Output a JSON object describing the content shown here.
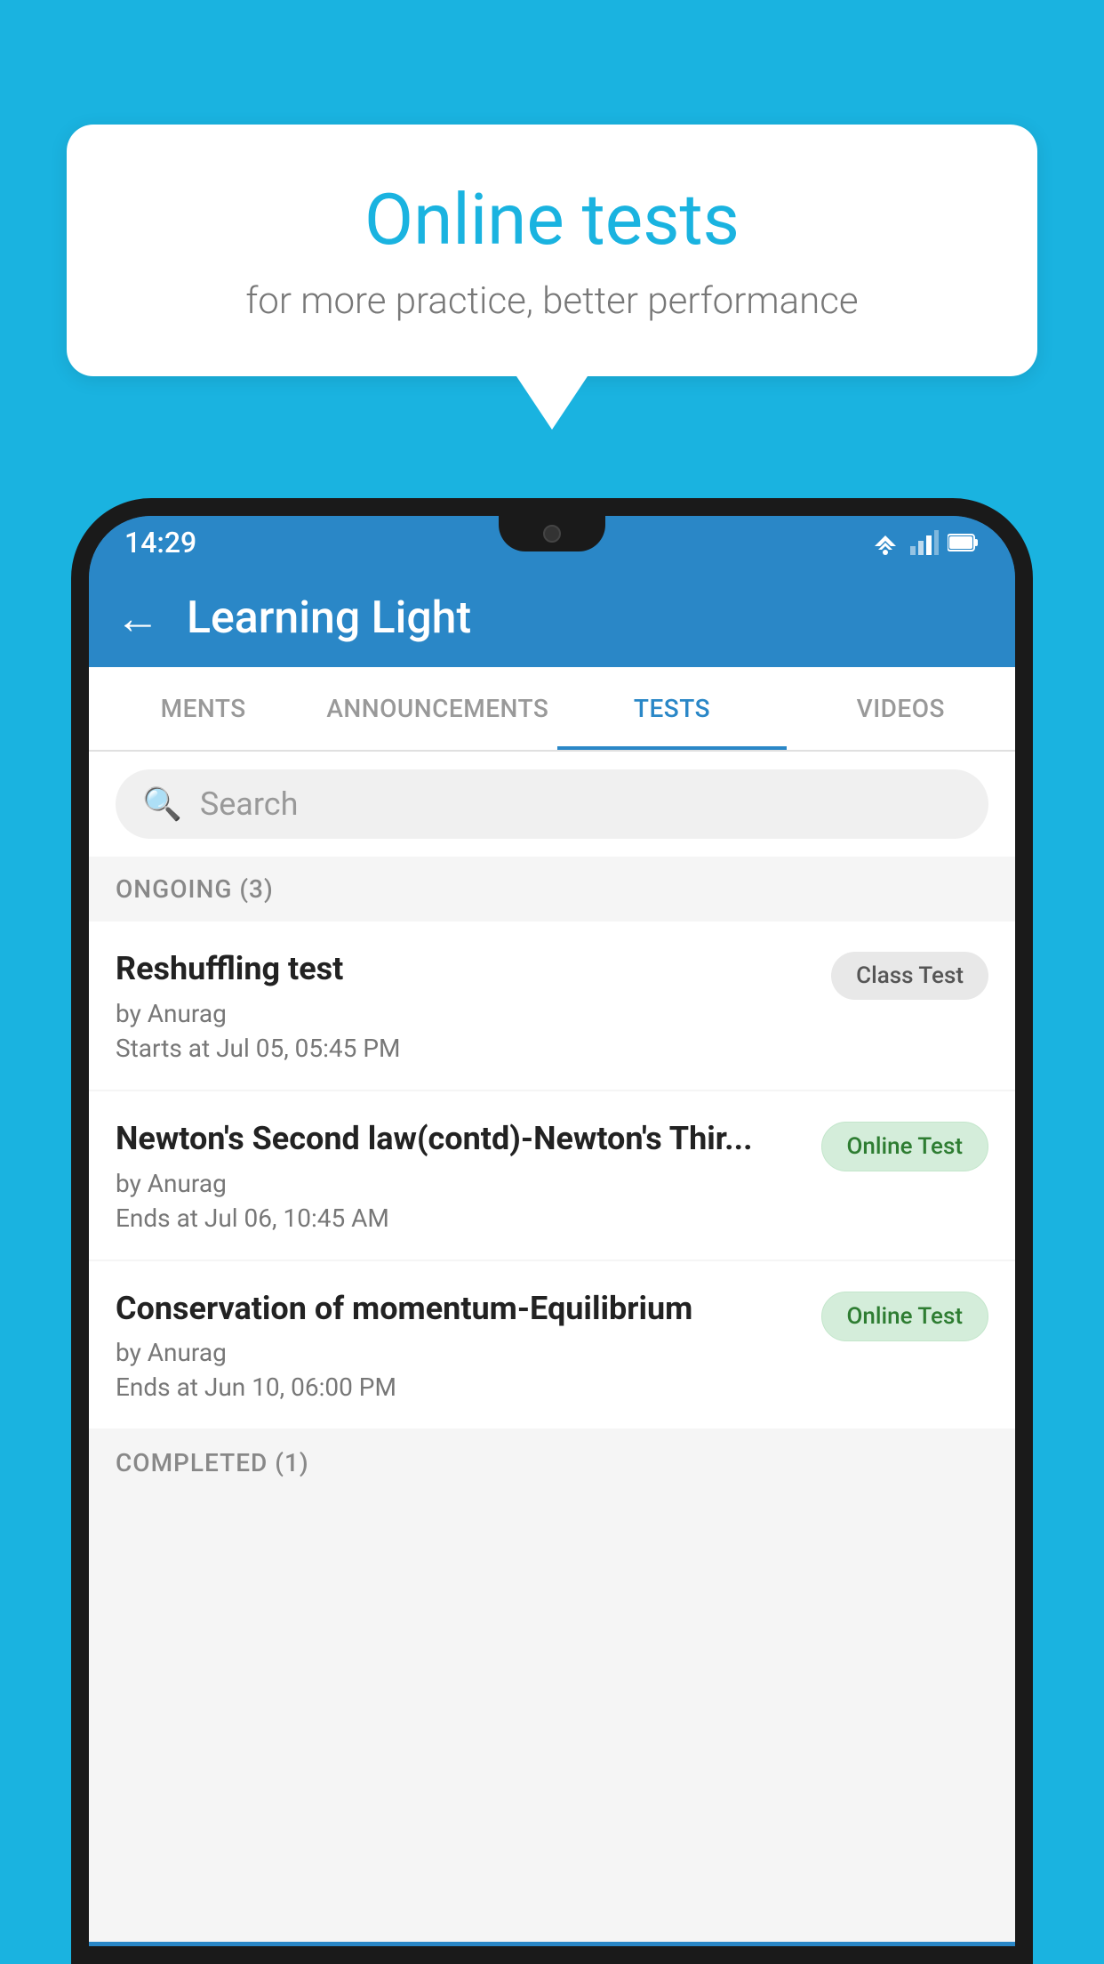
{
  "background_color": "#1ab3e0",
  "speech_bubble": {
    "title": "Online tests",
    "subtitle": "for more practice, better performance"
  },
  "status_bar": {
    "time": "14:29"
  },
  "app_bar": {
    "title": "Learning Light",
    "back_label": "←"
  },
  "tabs": [
    {
      "label": "MENTS",
      "active": false
    },
    {
      "label": "ANNOUNCEMENTS",
      "active": false
    },
    {
      "label": "TESTS",
      "active": true
    },
    {
      "label": "VIDEOS",
      "active": false
    }
  ],
  "search": {
    "placeholder": "Search"
  },
  "sections": [
    {
      "label": "ONGOING (3)",
      "tests": [
        {
          "title": "Reshuffling test",
          "author": "by Anurag",
          "time": "Starts at  Jul 05, 05:45 PM",
          "badge": "Class Test",
          "badge_type": "class"
        },
        {
          "title": "Newton's Second law(contd)-Newton's Thir...",
          "author": "by Anurag",
          "time": "Ends at  Jul 06, 10:45 AM",
          "badge": "Online Test",
          "badge_type": "online"
        },
        {
          "title": "Conservation of momentum-Equilibrium",
          "author": "by Anurag",
          "time": "Ends at  Jun 10, 06:00 PM",
          "badge": "Online Test",
          "badge_type": "online"
        }
      ]
    }
  ],
  "completed_section": {
    "label": "COMPLETED (1)"
  }
}
